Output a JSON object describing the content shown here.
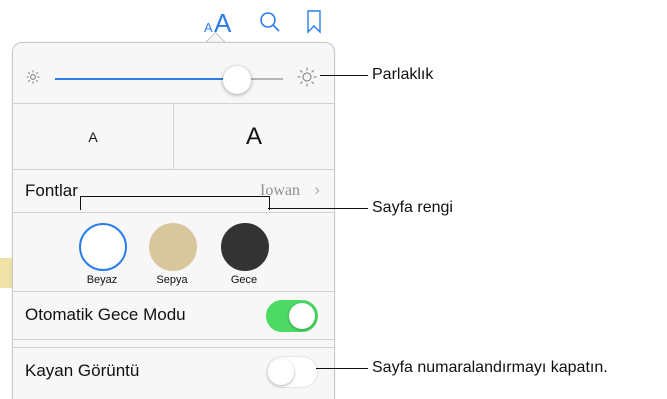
{
  "toolbar": {
    "text_size_small_glyph": "A",
    "text_size_large_glyph": "A",
    "icons": [
      "font-size-icon",
      "search-icon",
      "bookmark-icon"
    ]
  },
  "brightness": {
    "level": 0.8,
    "icons": [
      "sun-small-icon",
      "sun-large-icon"
    ]
  },
  "font_size": {
    "smaller_label": "A",
    "larger_label": "A"
  },
  "font": {
    "label": "Fontlar",
    "value": "Iowan",
    "chevron": "›"
  },
  "themes": [
    {
      "label": "Beyaz",
      "color": "#ffffff",
      "selected": true
    },
    {
      "label": "Sepya",
      "color": "#d8c79c",
      "selected": false
    },
    {
      "label": "Gece",
      "color": "#333333",
      "selected": false
    }
  ],
  "auto_night": {
    "label": "Otomatik Gece Modu",
    "on": true
  },
  "scrolling_view": {
    "label": "Kayan Görüntü",
    "on": false
  },
  "callouts": {
    "brightness": "Parlaklık",
    "page_color": "Sayfa rengi",
    "scrolling": "Sayfa numaralandırmayı kapatın."
  },
  "colors": {
    "accent": "#2b7de9",
    "toggle_on": "#4cd964",
    "toggle_off": "#e6e6e6"
  }
}
